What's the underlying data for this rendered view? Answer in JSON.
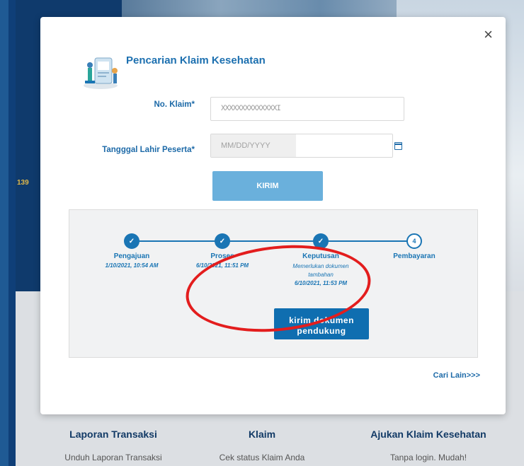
{
  "background": {
    "side_number": "139",
    "footer": [
      {
        "title": "Laporan Transaksi",
        "subtitle": "Unduh Laporan Transaksi"
      },
      {
        "title": "Klaim",
        "subtitle": "Cek status Klaim Anda"
      },
      {
        "title": "Ajukan Klaim Kesehatan",
        "subtitle": "Tanpa login. Mudah!"
      }
    ]
  },
  "modal": {
    "close_label": "×",
    "title": "Pencarian Klaim Kesehatan",
    "form": {
      "claim_label": "No. Klaim*",
      "claim_value": "XXXXXXXXXXXXXXI",
      "dob_label": "Tangggal Lahir Peserta*",
      "dob_placeholder": "MM/DD/YYYY",
      "submit_label": "KIRIM"
    },
    "status": {
      "steps": [
        {
          "label": "Pengajuan",
          "date": "1/10/2021, 10:54 AM",
          "done": true,
          "mark": "✓"
        },
        {
          "label": "Proses",
          "date": "6/10/2021, 11:51 PM",
          "done": true,
          "mark": "✓"
        },
        {
          "label": "Keputusan",
          "note_line1": "Memerlukan dokumen",
          "note_line2": "tambahan",
          "date": "6/10/2021, 11:53 PM",
          "done": true,
          "mark": "✓"
        },
        {
          "label": "Pembayaran",
          "done": false,
          "mark": "4"
        }
      ],
      "doc_button_line1": "kirim dokumen",
      "doc_button_line2": "pendukung"
    },
    "search_again": "Cari Lain>>>"
  },
  "colors": {
    "primary": "#1a75b4",
    "submit_button": "#6ab0dc",
    "doc_button": "#0f6eb0",
    "highlight": "#e31d1d",
    "hero_bg": "#0f3a6c"
  }
}
